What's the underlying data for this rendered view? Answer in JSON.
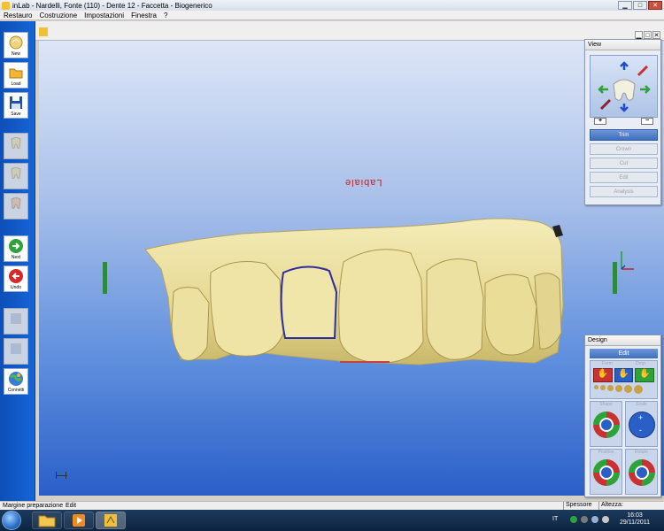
{
  "window": {
    "title": "inLab - Nardelli, Fonte (110) - Dente 12 - Faccetta - Biogenerico"
  },
  "menu": [
    "Restauro",
    "Costruzione",
    "Impostazioni",
    "Finestra",
    "?"
  ],
  "toolbar": [
    {
      "label": "New",
      "icon": "new-icon",
      "enabled": true
    },
    {
      "label": "Load",
      "icon": "folder-icon",
      "enabled": true
    },
    {
      "label": "Save",
      "icon": "floppy-icon",
      "enabled": true
    },
    {
      "label": "",
      "icon": "tooth-icon",
      "enabled": false
    },
    {
      "label": "",
      "icon": "tooth-icon",
      "enabled": false
    },
    {
      "label": "",
      "icon": "tooth-icon",
      "enabled": false
    },
    {
      "label": "Next",
      "icon": "next-arrow-icon",
      "enabled": true
    },
    {
      "label": "Undo",
      "icon": "undo-arrow-icon",
      "enabled": true
    },
    {
      "label": "",
      "icon": "tool-icon",
      "enabled": false
    },
    {
      "label": "",
      "icon": "tool-icon",
      "enabled": false
    },
    {
      "label": "Connetti",
      "icon": "globe-icon",
      "enabled": true
    }
  ],
  "viewport": {
    "model_label": "Labiale",
    "colors": {
      "background_top": "#dde6f6",
      "background_bottom": "#2b5fc8",
      "teeth": "#eee3a0",
      "margin_line": "#2d2fa0"
    }
  },
  "view_panel": {
    "title": "View",
    "zoom_in": "+",
    "zoom_out": "−",
    "buttons": [
      {
        "label": "Trim",
        "active": true
      },
      {
        "label": "Crown",
        "active": false
      },
      {
        "label": "Cut",
        "active": false
      },
      {
        "label": "Edit",
        "active": false
      },
      {
        "label": "Analysis",
        "active": false
      }
    ]
  },
  "design_panel": {
    "title": "Design",
    "edit_label": "Edit",
    "tool_groups": [
      "Form",
      "Drop",
      "Shape",
      "Scale",
      "Position",
      "Rotate"
    ]
  },
  "statusbar": {
    "mode": "Margine preparazione",
    "action": "Edit",
    "spessore": "Spessore",
    "altezza": "Altezza:"
  },
  "taskbar": {
    "language": "IT",
    "time": "16:03",
    "date": "29/11/2011"
  }
}
